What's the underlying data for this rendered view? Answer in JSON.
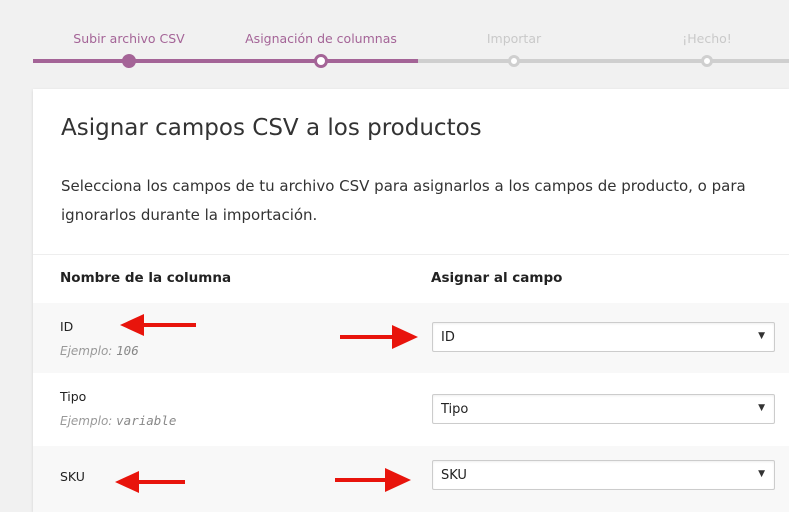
{
  "steps": [
    {
      "label": "Subir archivo CSV",
      "state": "done"
    },
    {
      "label": "Asignación de columnas",
      "state": "active"
    },
    {
      "label": "Importar",
      "state": "pending"
    },
    {
      "label": "¡Hecho!",
      "state": "pending"
    }
  ],
  "card": {
    "title": "Asignar campos CSV a los productos",
    "description": "Selecciona los campos de tu archivo CSV para asignarlos a los campos de producto, o para ignorarlos durante la importación."
  },
  "table": {
    "headers": {
      "column_name": "Nombre de la columna",
      "map_to": "Asignar al campo"
    },
    "example_label": "Ejemplo:",
    "rows": [
      {
        "name": "ID",
        "example": "106",
        "selected": "ID"
      },
      {
        "name": "Tipo",
        "example": "variable",
        "selected": "Tipo"
      },
      {
        "name": "SKU",
        "example": "",
        "selected": "SKU"
      }
    ]
  },
  "annotations": {
    "arrow_color": "#e8140c"
  },
  "colors": {
    "accent": "#a46497",
    "track_pending": "#cfcfcf"
  }
}
